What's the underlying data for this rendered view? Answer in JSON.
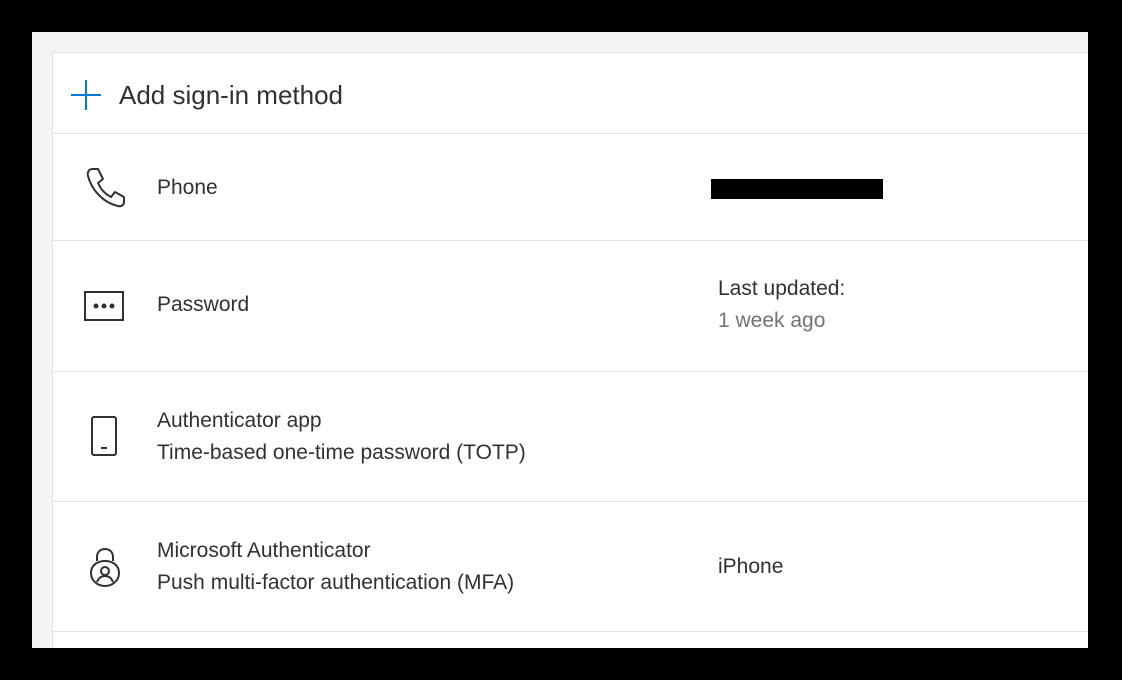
{
  "add_method": {
    "label": "Add sign-in method",
    "icon": "plus-icon"
  },
  "methods": [
    {
      "name": "Phone",
      "icon": "phone-icon",
      "detail": ""
    },
    {
      "name": "Password",
      "icon": "password-dots-icon",
      "detail": "Last updated:",
      "detail_sub": "1 week ago"
    },
    {
      "name": "Authenticator app",
      "subtitle": "Time-based one-time password (TOTP)",
      "icon": "mobile-device-icon"
    },
    {
      "name": "Microsoft Authenticator",
      "subtitle": "Push multi-factor authentication (MFA)",
      "icon": "authenticator-lock-icon",
      "detail": "iPhone"
    }
  ],
  "colors": {
    "accent": "#0078d4",
    "text": "#323130",
    "secondary_text": "#737373",
    "divider": "#e1e1e1"
  }
}
